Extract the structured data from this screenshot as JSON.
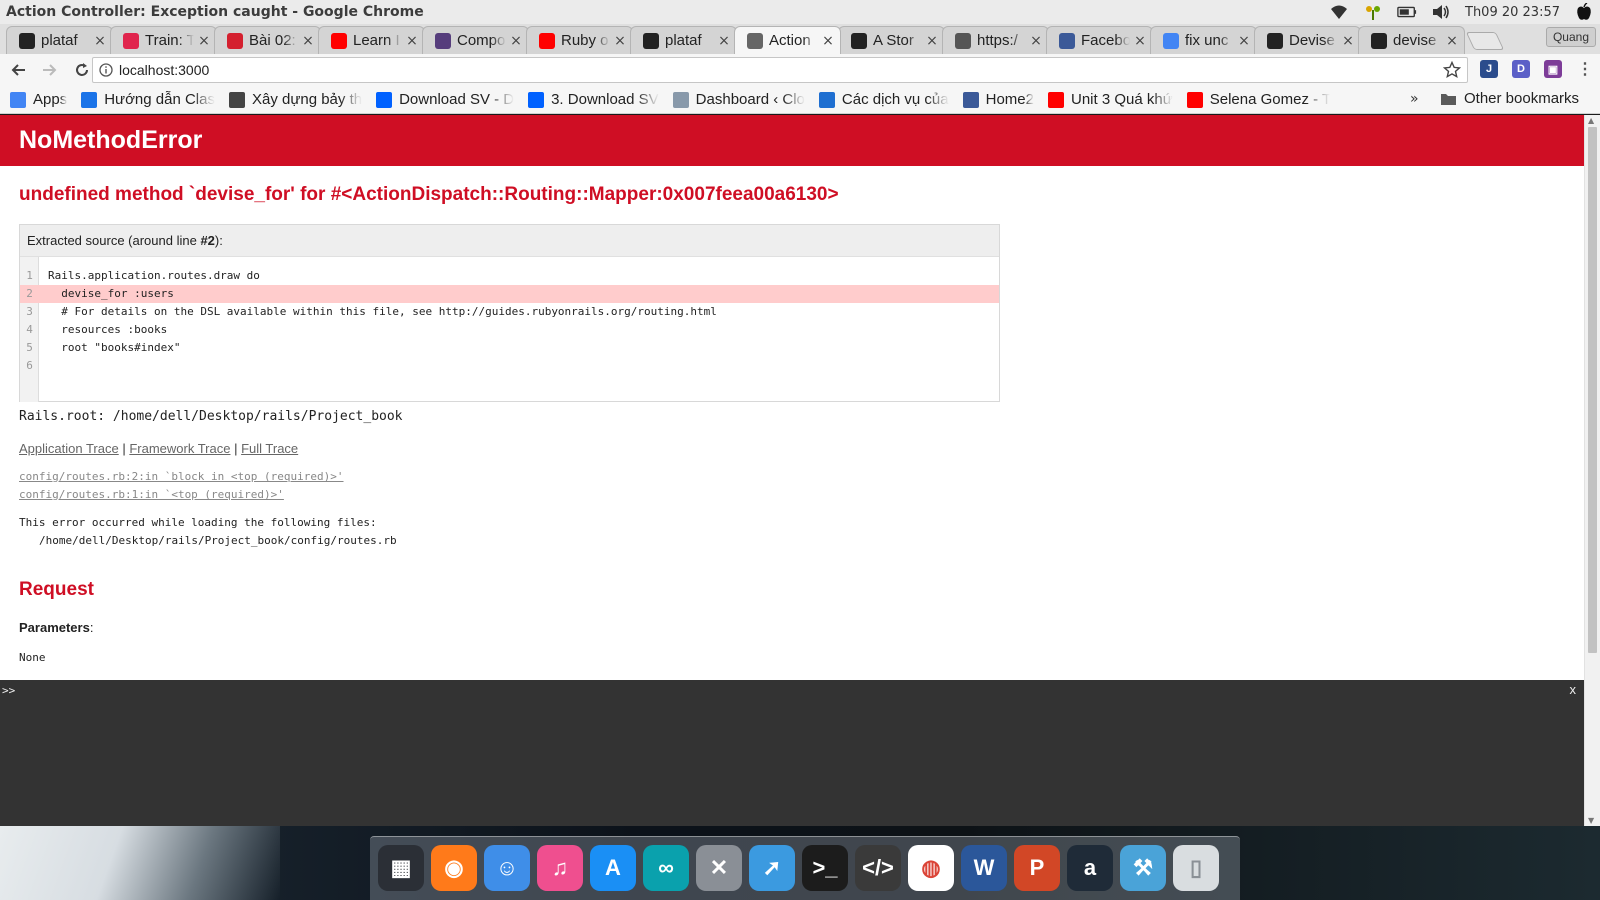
{
  "window": {
    "title": "Action Controller: Exception caught - Google Chrome"
  },
  "system_tray": {
    "clock": "Th09 20 23:57",
    "icons": [
      "wifi-icon",
      "flower-icon",
      "battery-icon",
      "volume-icon",
      "apple-icon"
    ]
  },
  "tabs": [
    {
      "label": "plataf",
      "icon": "github-icon",
      "color": "#222222",
      "active": false
    },
    {
      "label": "Train: T",
      "icon": "railway-icon",
      "color": "#e0254d",
      "active": false
    },
    {
      "label": "Bài 02:",
      "icon": "t-icon",
      "color": "#d4202f",
      "active": false
    },
    {
      "label": "Learn I",
      "icon": "youtube-icon",
      "color": "#ff0000",
      "active": false
    },
    {
      "label": "Compo",
      "icon": "bootstrap-icon",
      "color": "#563d7c",
      "active": false
    },
    {
      "label": "Ruby o",
      "icon": "youtube-icon",
      "color": "#ff0000",
      "active": false
    },
    {
      "label": "plataf",
      "icon": "github-icon",
      "color": "#222222",
      "active": false
    },
    {
      "label": "Action",
      "icon": "document-icon",
      "color": "#666666",
      "active": true
    },
    {
      "label": "A Stor",
      "icon": "amazon-icon",
      "color": "#222222",
      "active": false
    },
    {
      "label": "https:/",
      "icon": "link-icon",
      "color": "#555555",
      "active": false
    },
    {
      "label": "Facebo",
      "icon": "facebook-icon",
      "color": "#3b5998",
      "active": false
    },
    {
      "label": "fix unc",
      "icon": "google-icon",
      "color": "#4285f4",
      "active": false
    },
    {
      "label": "Devise",
      "icon": "github-icon",
      "color": "#222222",
      "active": false
    },
    {
      "label": "devise",
      "icon": "github-icon",
      "color": "#222222",
      "active": false
    }
  ],
  "profile": {
    "name": "Quang"
  },
  "toolbar": {
    "url": "localhost:3000"
  },
  "bookmarks": {
    "items": [
      {
        "label": "Apps",
        "icon": "apps-grid-icon",
        "color": "#4285f4"
      },
      {
        "label": "Hướng dẫn Clas",
        "icon": "globe-icon",
        "color": "#1a73e8"
      },
      {
        "label": "Xây dựng bảy th",
        "icon": "cloud-icon",
        "color": "#444444"
      },
      {
        "label": "Download SV - D",
        "icon": "dropbox-icon",
        "color": "#0061ff"
      },
      {
        "label": "3. Download SV",
        "icon": "dropbox-icon",
        "color": "#0061ff"
      },
      {
        "label": "Dashboard ‹ Clo",
        "icon": "cloud-icon",
        "color": "#8899aa"
      },
      {
        "label": "Các dịch vụ của",
        "icon": "vps-icon",
        "color": "#1f6fd1"
      },
      {
        "label": "Home2",
        "icon": "facebook-icon",
        "color": "#3b5998"
      },
      {
        "label": "Unit 3 Quá khứ",
        "icon": "youtube-icon",
        "color": "#ff0000"
      },
      {
        "label": "Selena Gomez - T",
        "icon": "youtube-icon",
        "color": "#ff0000"
      }
    ],
    "more": "»",
    "other": "Other bookmarks"
  },
  "error": {
    "name": "NoMethodError",
    "message": "undefined method `devise_for' for #<ActionDispatch::Routing::Mapper:0x007feea00a6130>",
    "source_head_prefix": "Extracted source (around line ",
    "source_head_line": "#2",
    "source_head_suffix": "):",
    "source_lines": [
      {
        "num": "1",
        "code": "Rails.application.routes.draw do",
        "highlight": false
      },
      {
        "num": "2",
        "code": "  devise_for :users",
        "highlight": true
      },
      {
        "num": "3",
        "code": "  # For details on the DSL available within this file, see http://guides.rubyonrails.org/routing.html",
        "highlight": false
      },
      {
        "num": "4",
        "code": "  resources :books",
        "highlight": false
      },
      {
        "num": "5",
        "code": "  root \"books#index\"",
        "highlight": false
      },
      {
        "num": "6",
        "code": "",
        "highlight": false
      }
    ],
    "rails_root": "Rails.root: /home/dell/Desktop/rails/Project_book",
    "trace_links": [
      "Application Trace",
      "Framework Trace",
      "Full Trace"
    ],
    "trace_separator": " | ",
    "trace_lines": [
      "config/routes.rb:2:in `block in <top (required)>'",
      "config/routes.rb:1:in `<top (required)>'"
    ],
    "load_note": "This error occurred while loading the following files:",
    "load_file": "/home/dell/Desktop/rails/Project_book/config/routes.rb"
  },
  "request": {
    "heading": "Request",
    "params_label": "Parameters",
    "params_colon": ":",
    "params_value": "None"
  },
  "console": {
    "prompt": ">>",
    "close": "x"
  },
  "dock": {
    "apps": [
      {
        "name": "launchpad-icon",
        "color": "#2b2f36",
        "glyph": "▦"
      },
      {
        "name": "firefox-icon",
        "color": "#ff7a1a",
        "glyph": "◉"
      },
      {
        "name": "finder-icon",
        "color": "#3f8ee8",
        "glyph": "☺"
      },
      {
        "name": "itunes-icon",
        "color": "#ef4f8f",
        "glyph": "♫"
      },
      {
        "name": "app-store-icon",
        "color": "#1a8ff5",
        "glyph": "A"
      },
      {
        "name": "arduino-icon",
        "color": "#0aa1ad",
        "glyph": "∞"
      },
      {
        "name": "system-settings-icon",
        "color": "#8a8f96",
        "glyph": "✕"
      },
      {
        "name": "cursor-app-icon",
        "color": "#3b9ae0",
        "glyph": "➚"
      },
      {
        "name": "terminal-icon",
        "color": "#1c1c1c",
        "glyph": ">_"
      },
      {
        "name": "code-editor-icon",
        "color": "#3a3a3a",
        "glyph": "</>"
      },
      {
        "name": "chrome-icon",
        "color": "#ffffff",
        "glyph": "◍"
      },
      {
        "name": "word-icon",
        "color": "#2b579a",
        "glyph": "W"
      },
      {
        "name": "powerpoint-icon",
        "color": "#d24726",
        "glyph": "P"
      },
      {
        "name": "amazon-icon",
        "color": "#1f2b38",
        "glyph": "a"
      },
      {
        "name": "xcode-icon",
        "color": "#4aa3d8",
        "glyph": "⚒"
      },
      {
        "name": "trash-icon",
        "color": "#d9dde0",
        "glyph": "▯"
      }
    ]
  }
}
